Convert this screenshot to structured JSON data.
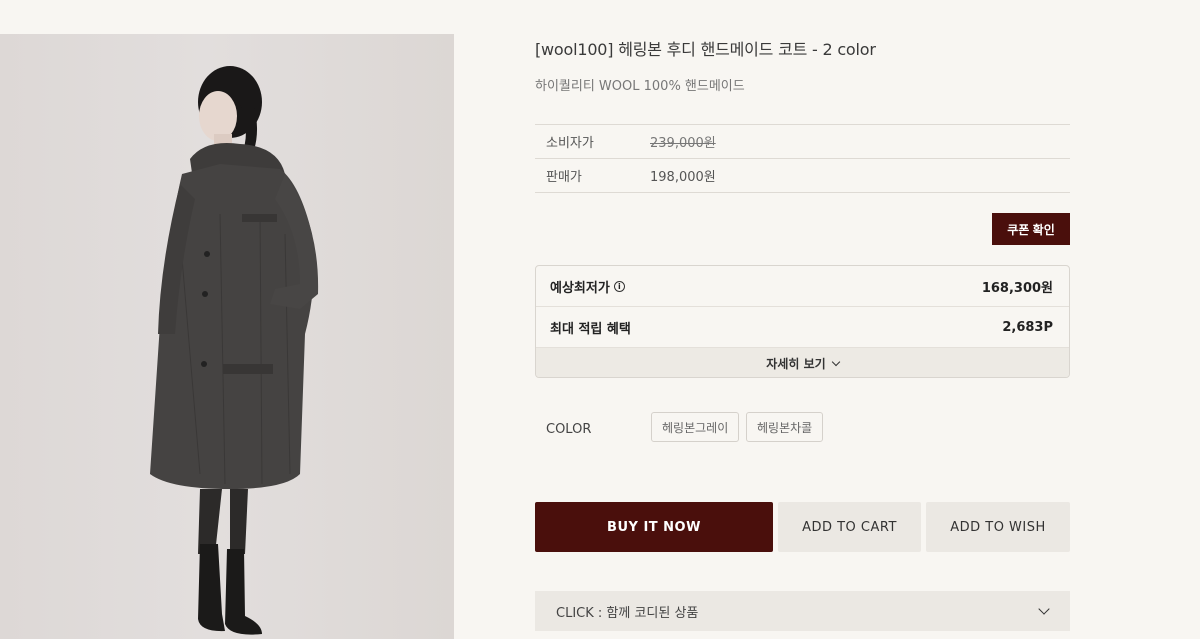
{
  "product": {
    "title": "[wool100] 헤링본 후디 핸드메이드 코트 - 2 color",
    "subtitle": "하이퀄리티 WOOL 100% 핸드메이드"
  },
  "prices": [
    {
      "label": "소비자가",
      "value": "239,000원",
      "strike": true
    },
    {
      "label": "판매가",
      "value": "198,000원",
      "strike": false
    }
  ],
  "coupon_button": "쿠폰 확인",
  "benefits": {
    "expected_price_label": "예상최저가",
    "expected_price_value": "168,300원",
    "points_label": "최대 적립 혜택",
    "points_value": "2,683P",
    "detail_toggle": "자세히 보기",
    "info_icon": "info-circle-icon"
  },
  "color": {
    "label": "COLOR",
    "options": [
      "헤링본그레이",
      "헤링본차콜"
    ]
  },
  "actions": {
    "buy": "BUY IT NOW",
    "cart": "ADD TO CART",
    "wish": "ADD TO WISH"
  },
  "coordi": {
    "label": "CLICK : 함께 코디된 상품",
    "icon": "chevron-down-icon"
  },
  "colors": {
    "accent": "#4a0f0c",
    "background": "#f8f6f2",
    "button_secondary": "#ebe8e3"
  }
}
